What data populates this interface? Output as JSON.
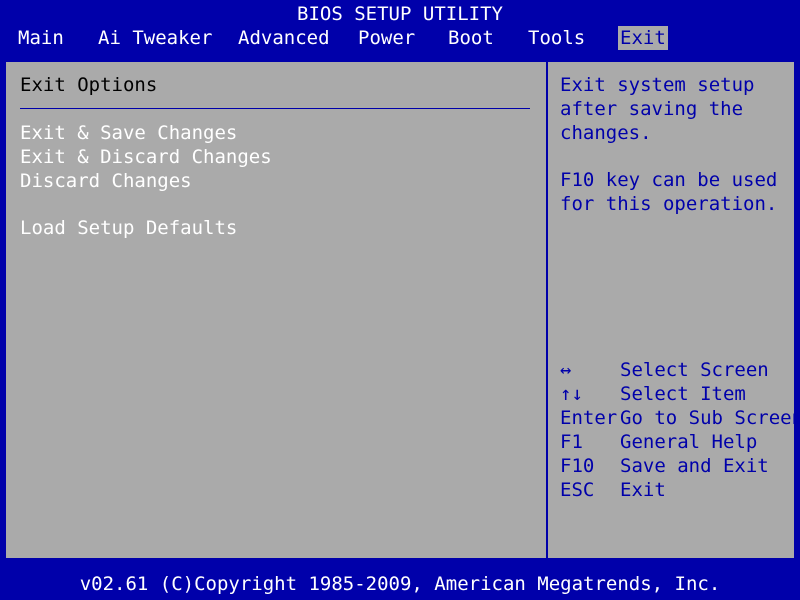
{
  "title": "BIOS SETUP UTILITY",
  "menu": [
    {
      "label": "Main"
    },
    {
      "label": "Ai Tweaker"
    },
    {
      "label": "Advanced"
    },
    {
      "label": "Power"
    },
    {
      "label": "Boot"
    },
    {
      "label": "Tools"
    },
    {
      "label": "Exit"
    }
  ],
  "active_menu": "Exit",
  "section_title": "Exit Options",
  "options": [
    {
      "label": "Exit & Save Changes"
    },
    {
      "label": "Exit & Discard Changes"
    },
    {
      "label": "Discard Changes"
    },
    {
      "label": "Load Setup Defaults"
    }
  ],
  "help": {
    "lines": [
      "Exit system setup",
      "after saving the",
      "changes.",
      "F10 key can be used",
      "for this operation."
    ]
  },
  "keys": [
    {
      "key": "↔",
      "desc": "Select Screen",
      "icon": "left-right-arrow-icon"
    },
    {
      "key": "↑↓",
      "desc": "Select Item",
      "icon": "up-down-arrow-icon"
    },
    {
      "key": "Enter",
      "desc": "Go to Sub Screen"
    },
    {
      "key": "F1",
      "desc": "General Help"
    },
    {
      "key": "F10",
      "desc": "Save and Exit"
    },
    {
      "key": "ESC",
      "desc": "Exit"
    }
  ],
  "footer": "v02.61 (C)Copyright 1985-2009, American Megatrends, Inc.",
  "colors": {
    "background": "#0000AA",
    "panel": "#AAAAAA",
    "text_white": "#FFFFFF",
    "text_black": "#000000",
    "text_blue": "#0000AA"
  }
}
